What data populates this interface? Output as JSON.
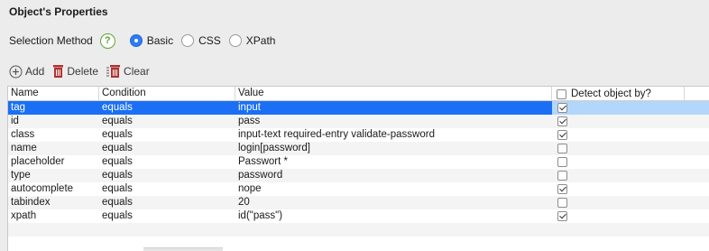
{
  "panel": {
    "title": "Object's Properties"
  },
  "selection": {
    "label": "Selection Method",
    "help_symbol": "?",
    "options": [
      {
        "label": "Basic",
        "selected": true
      },
      {
        "label": "CSS",
        "selected": false
      },
      {
        "label": "XPath",
        "selected": false
      }
    ]
  },
  "toolbar": {
    "add": "Add",
    "delete": "Delete",
    "clear": "Clear"
  },
  "table": {
    "headers": {
      "name": "Name",
      "condition": "Condition",
      "value": "Value",
      "detect": "Detect object by?"
    },
    "rows": [
      {
        "name": "tag",
        "condition": "equals",
        "value": "input",
        "checked": true,
        "selected": true
      },
      {
        "name": "id",
        "condition": "equals",
        "value": "pass",
        "checked": true
      },
      {
        "name": "class",
        "condition": "equals",
        "value": "input-text required-entry validate-password",
        "checked": true
      },
      {
        "name": "name",
        "condition": "equals",
        "value": "login[password]",
        "checked": false
      },
      {
        "name": "placeholder",
        "condition": "equals",
        "value": "Passwort *",
        "checked": false
      },
      {
        "name": "type",
        "condition": "equals",
        "value": "password",
        "checked": false
      },
      {
        "name": "autocomplete",
        "condition": "equals",
        "value": "nope",
        "checked": true
      },
      {
        "name": "tabindex",
        "condition": "equals",
        "value": "20",
        "checked": false
      },
      {
        "name": "xpath",
        "condition": "equals",
        "value": "id(\"pass\")",
        "checked": true
      }
    ]
  },
  "colors": {
    "selection": "#1a6ff5",
    "help": "#5aa531",
    "delete_icon": "#b03030"
  }
}
